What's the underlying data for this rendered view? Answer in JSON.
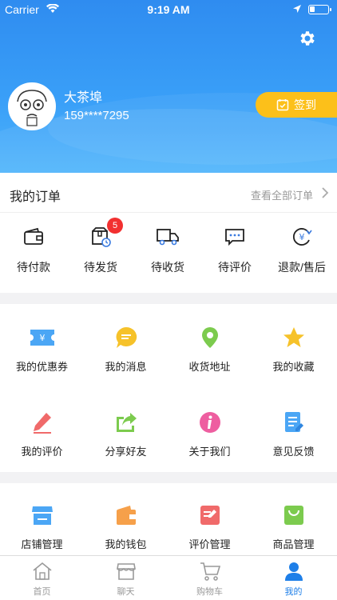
{
  "status_bar": {
    "carrier": "Carrier",
    "time": "9:19 AM"
  },
  "profile": {
    "name": "大茶埠",
    "phone": "159****7295",
    "checkin_label": "签到"
  },
  "orders": {
    "title": "我的订单",
    "view_all": "查看全部订单",
    "items": [
      {
        "label": "待付款",
        "icon": "wallet-icon"
      },
      {
        "label": "待发货",
        "icon": "box-icon",
        "badge": "5"
      },
      {
        "label": "待收货",
        "icon": "truck-icon"
      },
      {
        "label": "待评价",
        "icon": "comment-icon"
      },
      {
        "label": "退款/售后",
        "icon": "refund-icon"
      }
    ]
  },
  "services": {
    "items": [
      {
        "label": "我的优惠券",
        "icon": "coupon-icon"
      },
      {
        "label": "我的消息",
        "icon": "message-icon"
      },
      {
        "label": "收货地址",
        "icon": "location-icon"
      },
      {
        "label": "我的收藏",
        "icon": "star-icon"
      },
      {
        "label": "我的评价",
        "icon": "pen-icon"
      },
      {
        "label": "分享好友",
        "icon": "share-icon"
      },
      {
        "label": "关于我们",
        "icon": "info-icon"
      },
      {
        "label": "意见反馈",
        "icon": "feedback-icon"
      }
    ]
  },
  "manage": {
    "items": [
      {
        "label": "店铺管理",
        "icon": "store-icon"
      },
      {
        "label": "我的钱包",
        "icon": "wallet-orange-icon"
      },
      {
        "label": "评价管理",
        "icon": "review-manage-icon"
      },
      {
        "label": "商品管理",
        "icon": "bag-icon"
      }
    ]
  },
  "tabbar": {
    "items": [
      {
        "label": "首页",
        "icon": "home-icon"
      },
      {
        "label": "聊天",
        "icon": "shop-icon"
      },
      {
        "label": "购物车",
        "icon": "cart-icon"
      },
      {
        "label": "我的",
        "icon": "person-icon"
      }
    ]
  },
  "colors": {
    "primary": "#2f8cf0",
    "checkin": "#fcc01a",
    "badge": "#f23030",
    "active_tab": "#1e7fe8"
  }
}
